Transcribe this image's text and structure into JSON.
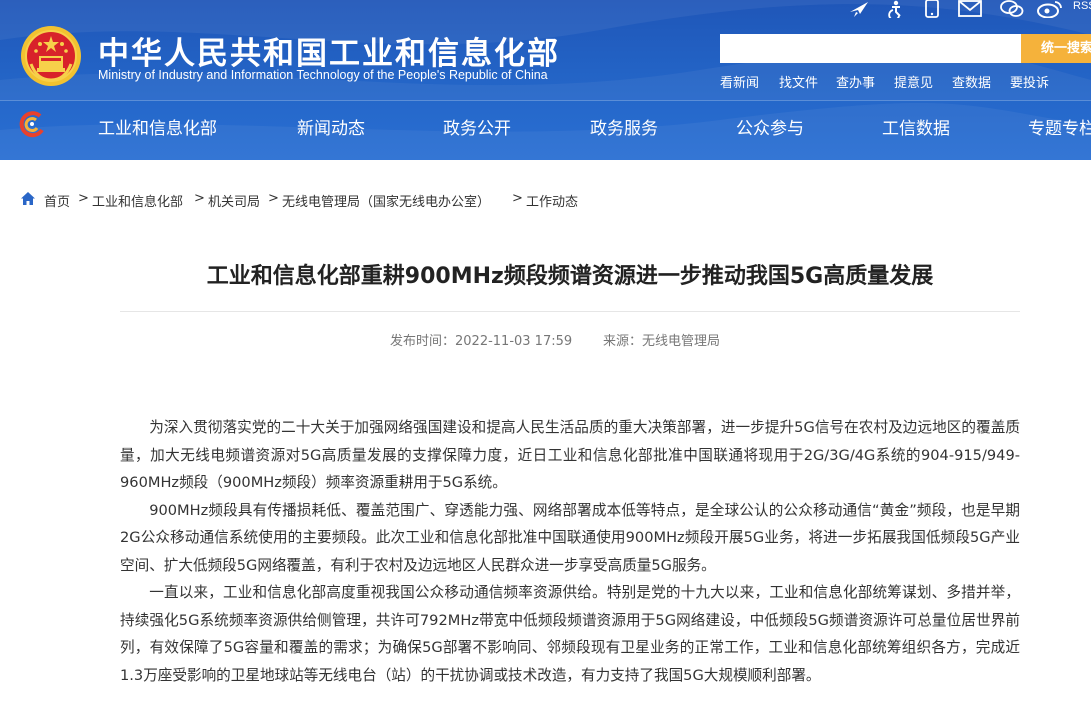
{
  "header": {
    "site_title": "中华人民共和国工业和信息化部",
    "site_subtitle": "Ministry of Industry and Information Technology of the People's Republic of China",
    "top_icons": [
      "airplane-icon",
      "accessibility-icon",
      "mobile-icon",
      "mail-icon",
      "wechat-icon",
      "weibo-icon"
    ],
    "rss_label": "RSS",
    "search": {
      "placeholder": "",
      "button_label": "统一搜索"
    },
    "quick_links": [
      "看新闻",
      "找文件",
      "查办事",
      "提意见",
      "查数据",
      "要投诉"
    ],
    "nav": [
      "工业和信息化部",
      "新闻动态",
      "政务公开",
      "政务服务",
      "公众参与",
      "工信数据",
      "专题专栏"
    ]
  },
  "breadcrumb": [
    "首页",
    "工业和信息化部",
    "机关司局",
    "无线电管理局（国家无线电办公室）",
    "工作动态"
  ],
  "article": {
    "title": "工业和信息化部重耕900MHz频段频谱资源进一步推动我国5G高质量发展",
    "publish_time": "发布时间：2022-11-03 17:59",
    "source": "来源：无线电管理局",
    "paragraphs": [
      "为深入贯彻落实党的二十大关于加强网络强国建设和提高人民生活品质的重大决策部署，进一步提升5G信号在农村及边远地区的覆盖质量，加大无线电频谱资源对5G高质量发展的支撑保障力度，近日工业和信息化部批准中国联通将现用于2G/3G/4G系统的904-915/949-960MHz频段（900MHz频段）频率资源重耕用于5G系统。",
      "900MHz频段具有传播损耗低、覆盖范围广、穿透能力强、网络部署成本低等特点，是全球公认的公众移动通信“黄金”频段，也是早期2G公众移动通信系统使用的主要频段。此次工业和信息化部批准中国联通使用900MHz频段开展5G业务，将进一步拓展我国低频段5G产业空间、扩大低频段5G网络覆盖，有利于农村及边远地区人民群众进一步享受高质量5G服务。",
      "一直以来，工业和信息化部高度重视我国公众移动通信频率资源供给。特别是党的十九大以来，工业和信息化部统筹谋划、多措并举，持续强化5G系统频率资源供给侧管理，共许可792MHz带宽中低频段频谱资源用于5G网络建设，中低频段5G频谱资源许可总量位居世界前列，有效保障了5G容量和覆盖的需求；为确保5G部署不影响同、邻频段现有卫星业务的正常工作，工业和信息化部统筹组织各方，完成近1.3万座受影响的卫星地球站等无线电台（站）的干扰协调或技术改造，有力支持了我国5G大规模顺利部署。"
    ]
  }
}
